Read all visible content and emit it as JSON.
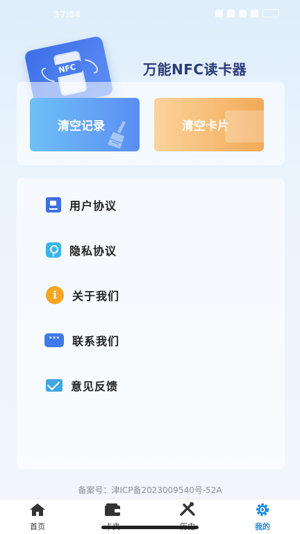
{
  "status_bar": {
    "time": "17:54"
  },
  "header": {
    "title": "万能NFC读卡器",
    "hero_badge": "NFC"
  },
  "actions": {
    "clear_records": "清空记录",
    "clear_cards": "清空卡片"
  },
  "menu": {
    "items": [
      {
        "label": "用户协议",
        "icon": "document-icon"
      },
      {
        "label": "隐私协议",
        "icon": "key-icon"
      },
      {
        "label": "关于我们",
        "icon": "info-icon"
      },
      {
        "label": "联系我们",
        "icon": "chat-icon"
      },
      {
        "label": "意见反馈",
        "icon": "mail-icon"
      }
    ]
  },
  "footer": {
    "icp": "备案号：津ICP备2023009540号-52A"
  },
  "tabs": [
    {
      "label": "首页",
      "icon": "home-icon"
    },
    {
      "label": "卡夹",
      "icon": "wallet-icon"
    },
    {
      "label": "历史",
      "icon": "tools-icon"
    },
    {
      "label": "我的",
      "icon": "gear-icon",
      "active": true
    }
  ],
  "colors": {
    "accent": "#1e88e5",
    "title": "#2a3a7a",
    "clear_records_gradient": [
      "#6fc0f8",
      "#5a8ef2"
    ],
    "clear_cards_gradient": [
      "#fbd39b",
      "#f2aa58"
    ]
  }
}
